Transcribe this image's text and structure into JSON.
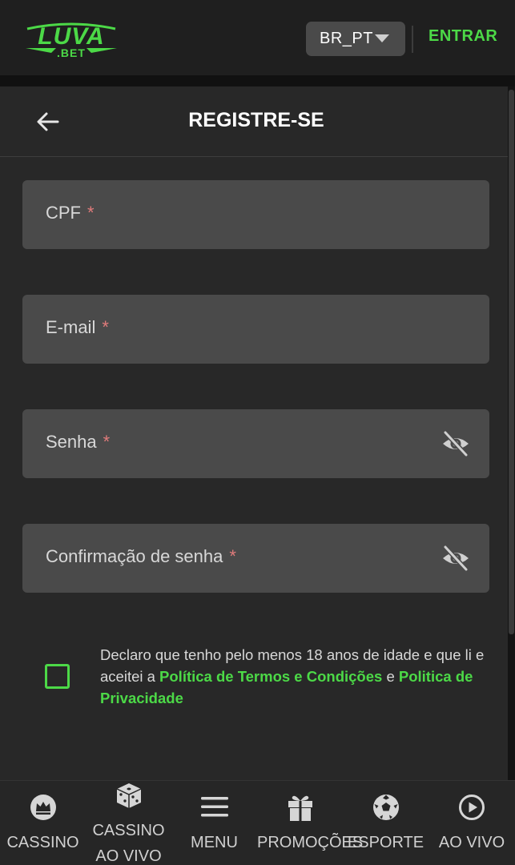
{
  "header": {
    "logo_text": "LUVA",
    "logo_subtext": ".BET",
    "language": "BR_PT",
    "login_label": "ENTRAR"
  },
  "page": {
    "title": "REGISTRE-SE"
  },
  "form": {
    "required_mark": "*",
    "fields": [
      {
        "label": "CPF",
        "type": "text"
      },
      {
        "label": "E-mail",
        "type": "email"
      },
      {
        "label": "Senha",
        "type": "password"
      },
      {
        "label": "Confirmação de senha",
        "type": "password"
      }
    ],
    "consent": {
      "checked": false,
      "text_before": "Declaro que tenho pelo menos 18 anos de idade e que li e aceitei a ",
      "link_terms": "Política de Termos e Condições",
      "text_middle": " e ",
      "link_privacy": "Politica de Privacidade"
    }
  },
  "bottom_nav": [
    {
      "label": "CASSINO",
      "icon": "crown-icon"
    },
    {
      "label": "CASSINO AO VIVO",
      "label_line1": "CASSINO",
      "label_line2": "AO VIVO",
      "icon": "dice-icon"
    },
    {
      "label": "MENU",
      "icon": "hamburger-icon"
    },
    {
      "label": "PROMOÇÕES",
      "icon": "gift-icon"
    },
    {
      "label": "ESPORTE",
      "icon": "soccer-ball-icon"
    },
    {
      "label": "AO VIVO",
      "icon": "play-circle-icon"
    }
  ],
  "colors": {
    "accent_green": "#4cd947",
    "required_red": "#e07b7b",
    "field_bg": "#4a4a4a",
    "panel_bg": "#282828"
  }
}
